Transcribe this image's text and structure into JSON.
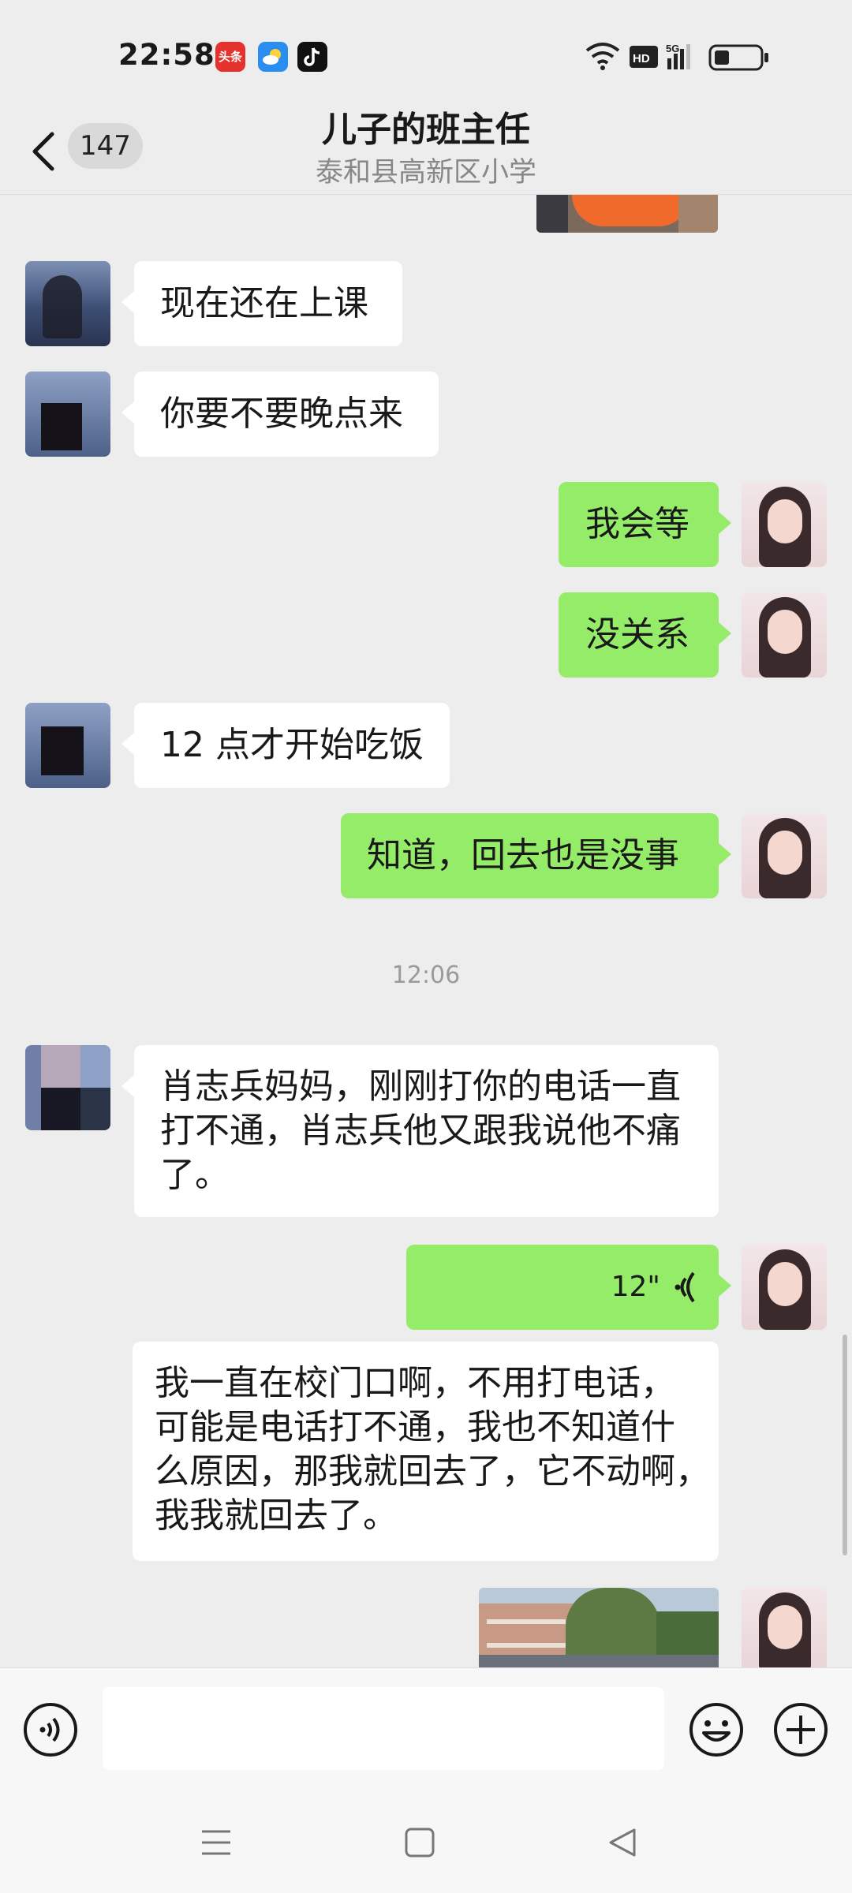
{
  "status_bar": {
    "time": "22:58",
    "apps": [
      "头条",
      "weather-icon",
      "tiktok-icon"
    ],
    "icons": [
      "wifi-icon",
      "hd-icon",
      "signal-5g-icon",
      "battery-icon"
    ]
  },
  "header": {
    "unread_count": "147",
    "title": "儿子的班主任",
    "subtitle": "泰和县高新区小学"
  },
  "messages": [
    {
      "from": "other",
      "text": "现在还在上课"
    },
    {
      "from": "other",
      "text": "你要不要晚点来"
    },
    {
      "from": "me",
      "text": "我会等"
    },
    {
      "from": "me",
      "text": "没关系"
    },
    {
      "from": "other",
      "text": "12 点才开始吃饭"
    },
    {
      "from": "me",
      "text": "知道，回去也是没事"
    },
    {
      "timestamp": "12:06"
    },
    {
      "from": "other",
      "lines": [
        "肖志兵妈妈，刚刚打你的电话一直",
        "打不通，肖志兵他又跟我说他不痛",
        "了。"
      ]
    },
    {
      "from": "me",
      "voice": "12\""
    },
    {
      "from": "transcript",
      "lines": [
        "我一直在校门口啊，不用打电话，",
        "可能是电话打不通，我也不知道什",
        "么原因，那我就回去了，它不动啊，",
        "我我就回去了。"
      ]
    }
  ],
  "colors": {
    "background": "#ededed",
    "outgoing_bubble": "#95ec69",
    "incoming_bubble": "#ffffff"
  },
  "input_bar": {
    "icons": [
      "voice-input-icon",
      "emoji-icon",
      "plus-icon"
    ]
  },
  "nav_bar": {
    "icons": [
      "menu-icon",
      "home-icon",
      "back-triangle-icon"
    ]
  }
}
